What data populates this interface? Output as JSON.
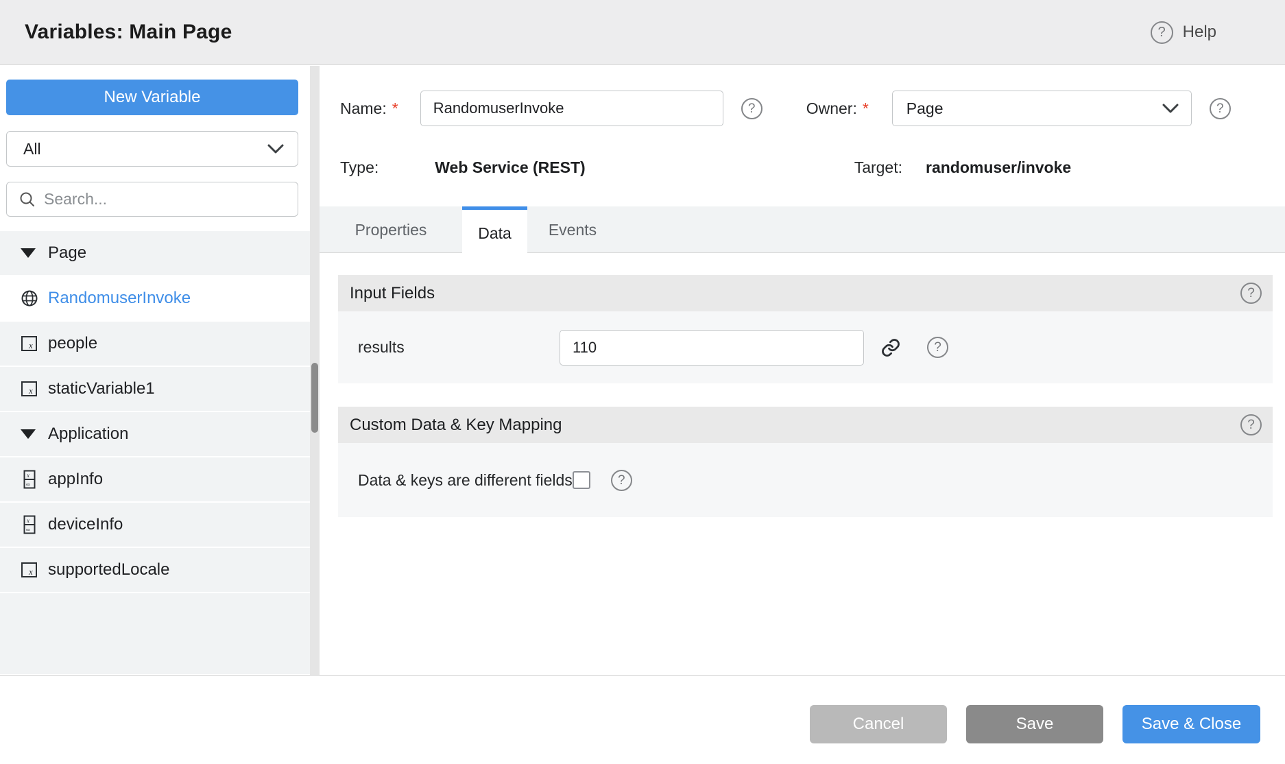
{
  "header": {
    "title": "Variables: Main Page",
    "help_label": "Help"
  },
  "sidebar": {
    "new_variable_label": "New Variable",
    "filter_value": "All",
    "search_placeholder": "Search...",
    "items": [
      {
        "label": "Page",
        "type": "group"
      },
      {
        "label": "RandomuserInvoke",
        "type": "service",
        "selected": true
      },
      {
        "label": "people",
        "type": "static"
      },
      {
        "label": "staticVariable1",
        "type": "static"
      },
      {
        "label": "Application",
        "type": "group"
      },
      {
        "label": "appInfo",
        "type": "system"
      },
      {
        "label": "deviceInfo",
        "type": "system"
      },
      {
        "label": "supportedLocale",
        "type": "static"
      }
    ]
  },
  "form": {
    "name": {
      "label": "Name:",
      "required": "*",
      "value": "RandomuserInvoke"
    },
    "owner": {
      "label": "Owner:",
      "required": "*",
      "value": "Page"
    },
    "type": {
      "label": "Type:",
      "value": "Web Service (REST)"
    },
    "target": {
      "label": "Target:",
      "value": "randomuser/invoke"
    }
  },
  "tabs": [
    {
      "label": "Properties",
      "active": false
    },
    {
      "label": "Data",
      "active": true
    },
    {
      "label": "Events",
      "active": false
    }
  ],
  "sections": {
    "input_fields": {
      "title": "Input Fields",
      "field_label": "results",
      "field_value": "110"
    },
    "custom_mapping": {
      "title": "Custom Data & Key Mapping",
      "checkbox_label": "Data & keys are different fields",
      "checked": false
    }
  },
  "footer": {
    "cancel_label": "Cancel",
    "save_label": "Save",
    "save_close_label": "Save & Close"
  },
  "colors": {
    "accent_blue": "#4592e6",
    "selected_item_text": "#3f8ee8",
    "tab_underline": "#3f8ee8",
    "header_bg": "#ededee",
    "row_bg": "#f1f3f4",
    "section_header_bg": "#e9e9e9",
    "section_body_bg": "#f6f7f8",
    "cancel_gray": "#b9b9b9",
    "save_gray": "#8a8a8a",
    "required_red": "#e8402a"
  }
}
